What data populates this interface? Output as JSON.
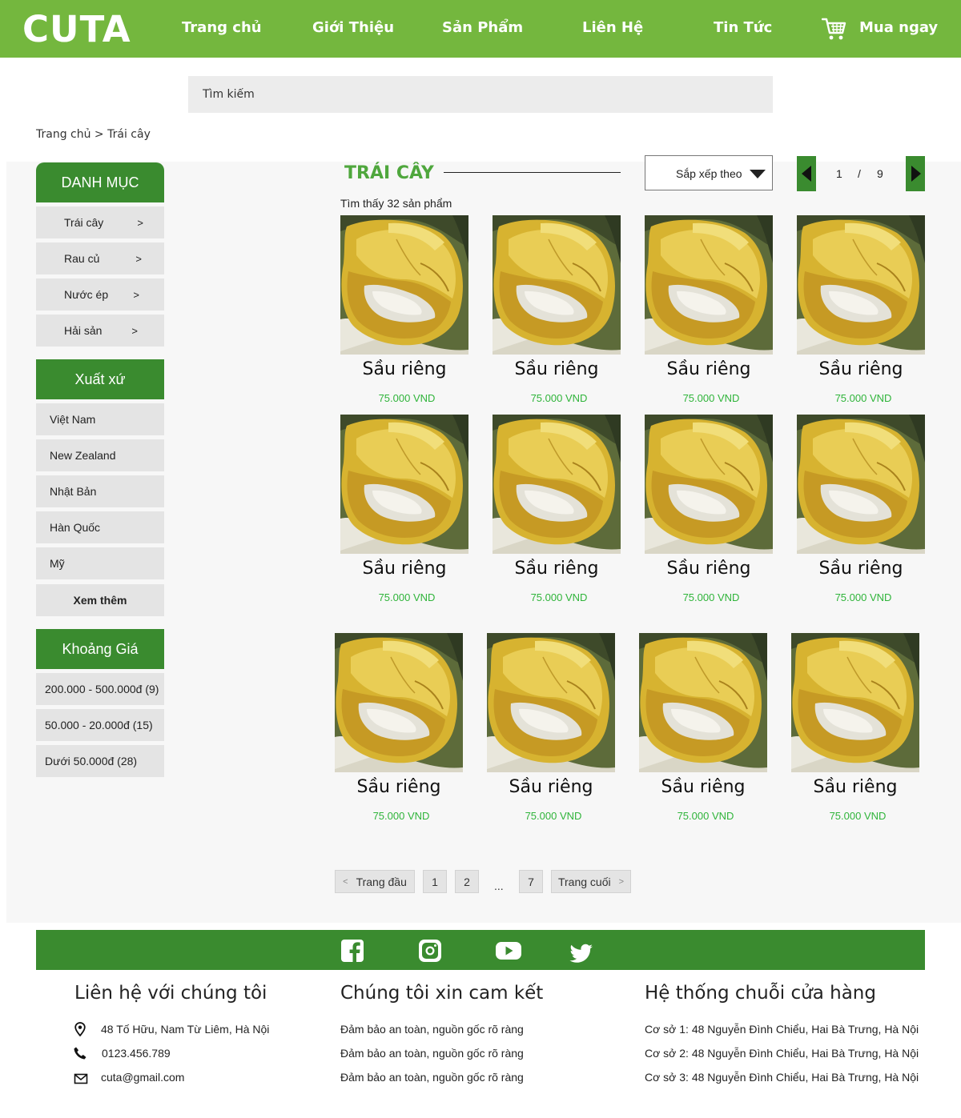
{
  "header": {
    "logo": "CUTA",
    "nav": [
      "Trang chủ",
      "Giới Thiệu",
      "Sản Phẩm",
      "Liên Hệ",
      "Tin Tức"
    ],
    "buy_now": "Mua ngay"
  },
  "search": {
    "placeholder": "Tìm kiếm"
  },
  "breadcrumb": {
    "home": "Trang chủ",
    "sep": " > ",
    "current": "Trái cây"
  },
  "sidebar": {
    "category_title": "DANH MỤC",
    "categories": [
      {
        "label": "Trái cây",
        "arrow": ">"
      },
      {
        "label": "Rau củ",
        "arrow": ">"
      },
      {
        "label": "Nước ép",
        "arrow": ">"
      },
      {
        "label": "Hải sản",
        "arrow": ">"
      }
    ],
    "origin_title": "Xuất xứ",
    "origins": [
      "Việt Nam",
      "New Zealand",
      "Nhật Bản",
      "Hàn Quốc",
      "Mỹ"
    ],
    "more": "Xem thêm",
    "price_title": "Khoảng Giá",
    "prices": [
      "200.000 - 500.000đ (9)",
      "50.000 - 20.000đ (15)",
      "Dưới 50.000đ (28)"
    ]
  },
  "main": {
    "title": "TRÁI CÂY",
    "sort_label": "Sắp xếp theo",
    "page_current": "1",
    "page_sep": "/",
    "page_total": "9",
    "found_text": "Tìm thấy 32 sản phẩm",
    "products": [
      {
        "name": "Sầu riêng",
        "price": "75.000 VND"
      },
      {
        "name": "Sầu riêng",
        "price": "75.000 VND"
      },
      {
        "name": "Sầu riêng",
        "price": "75.000 VND"
      },
      {
        "name": "Sầu riêng",
        "price": "75.000 VND"
      },
      {
        "name": "Sầu riêng",
        "price": "75.000 VND"
      },
      {
        "name": "Sầu riêng",
        "price": "75.000 VND"
      },
      {
        "name": "Sầu riêng",
        "price": "75.000 VND"
      },
      {
        "name": "Sầu riêng",
        "price": "75.000 VND"
      },
      {
        "name": "Sầu riêng",
        "price": "75.000 VND"
      },
      {
        "name": "Sầu riêng",
        "price": "75.000 VND"
      },
      {
        "name": "Sầu riêng",
        "price": "75.000 VND"
      },
      {
        "name": "Sầu riêng",
        "price": "75.000 VND"
      }
    ]
  },
  "pagination": {
    "first": "Trang đầu",
    "first_arrow": "<",
    "pages": [
      "1",
      "2"
    ],
    "ellipsis": "...",
    "last_page": "7",
    "last": "Trang cuối",
    "last_arrow": ">"
  },
  "footer": {
    "social_icons": [
      "facebook-icon",
      "instagram-icon",
      "youtube-icon",
      "twitter-icon"
    ],
    "contact": {
      "title": "Liên hệ với chúng tôi",
      "address": "48 Tố Hữu, Nam Từ Liêm, Hà Nội",
      "phone": "0123.456.789",
      "email": "cuta@gmail.com"
    },
    "commit": {
      "title": "Chúng tôi xin cam kết",
      "lines": [
        "Đảm bảo an toàn, nguồn gốc rõ ràng",
        "Đảm bảo an toàn, nguồn gốc rõ ràng",
        "Đảm bảo an toàn, nguồn gốc rõ ràng"
      ]
    },
    "stores": {
      "title": "Hệ thống chuỗi cửa hàng",
      "lines": [
        "Cơ sở 1: 48 Nguyễn Đình Chiểu, Hai Bà Trưng, Hà Nội",
        "Cơ sở 2: 48 Nguyễn Đình Chiểu, Hai Bà Trưng, Hà Nội",
        "Cơ sở 3: 48 Nguyễn Đình Chiểu, Hai Bà Trưng, Hà Nội"
      ]
    }
  },
  "colors": {
    "header": "#74b73e",
    "accent": "#3a8b2f",
    "price": "#2fb43a"
  }
}
